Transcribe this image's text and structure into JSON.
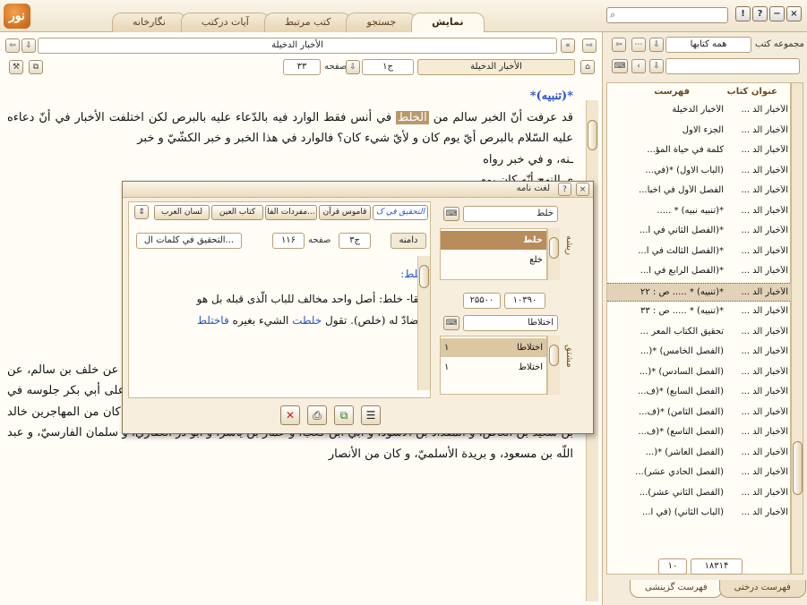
{
  "app": {
    "logo_text": "نور",
    "tabs": [
      {
        "label": "نگارخانه"
      },
      {
        "label": "آیات درکتب"
      },
      {
        "label": "کتب مرتبط"
      },
      {
        "label": "جستجو"
      },
      {
        "label": "نمایش"
      }
    ],
    "window_buttons": [
      "×",
      "−",
      "?",
      "!"
    ]
  },
  "reader": {
    "book_title": "الأخبار الدخيلة",
    "book_field": "الأخبار الدخيلة",
    "volume": "ج۱",
    "page_label": "صفحه",
    "page_number": "۳۳",
    "heading": "*(تنبيه)*",
    "highlight_word": "الخلط",
    "paragraphs": [
      "قد عرفت أنّ الخبر سالم من",
      "في أنس فقط الوارد فيه بالدّعاء عليه بالبرص لكن اختلفت الأخبار في أنّ دعاءه عليه السّلام بالبرص أيّ يوم كان و لأيّ شيء كان؟ فالوارد في هذا الخبر و خبر الكشّيّ و خبر",
      "ـنه، و في خبر رواه",
      "ي النهج أنّه كان يوم",
      "ـامته لا يمكنه، و في",
      "بي بكر جلوسه في",
      "الخلافة» عن عليّ بن أحمد بن عبد اللّه بن أحمد البرقيّ، عن أبيه، عن جدّه أحمد، عن النهيكيّ، عن خلف بن سالم، عن محمّد بن جعفر، عن شعبة، عن عثمان بن المغيرة، عن زيد بن وهب، قال: «كان الّذين أنكروا على أبي بكر جلوسه في الخلافة و تقدّمه على عليّ بن أبي طالب عليه السّلام اثني عشر رجلا من المهاجرين و الأنصار، كان من المهاجرين خالد بن سعيد بن العاص، و المقداد بن الأسود، و أبيّ ابن كعب، و عمّار بن ياسر، و أبو ذرّ الغفاريّ، و سلمان الفارسيّ، و عبد اللّه بن مسعود، و بريدة الأسلميّ، و كان من الأنصار"
    ]
  },
  "side": {
    "collection_label": "مجموعه کتب",
    "collection_value": "همه کتابها",
    "col_title": "عنوان کتاب",
    "col_index": "فهرست",
    "rows": [
      {
        "book": "الأخبار الد ...",
        "index": "الأخبار الدخيلة"
      },
      {
        "book": "الأخبار الد ...",
        "index": "الجزء الاول"
      },
      {
        "book": "الأخبار الد ...",
        "index": "كلمة في حياة المؤ..."
      },
      {
        "book": "الأخبار الد ...",
        "index": "(الباب الاول) *(في..."
      },
      {
        "book": "الأخبار الد ...",
        "index": "الفصل الأول في أخبا..."
      },
      {
        "book": "الأخبار الد ...",
        "index": "*(تنبيه نبيه) * ....."
      },
      {
        "book": "الأخبار الد ...",
        "index": "*(الفصل الثاني في أ..."
      },
      {
        "book": "الأخبار الد ...",
        "index": "*(الفصل الثالث في أ..."
      },
      {
        "book": "الأخبار الد ...",
        "index": "*(الفصل الرابع في ا..."
      },
      {
        "book": "الأخبار الد ...",
        "index": "*(تنبيه) * ..... ص : ۲۲"
      },
      {
        "book": "الأخبار الد ...",
        "index": "*(تنبيه) * ..... ص : ۳۳"
      },
      {
        "book": "الأخبار الد ...",
        "index": "تحقيق الكتاب المعر ..."
      },
      {
        "book": "الأخبار الد ...",
        "index": "(الفصل الخامس) *(..."
      },
      {
        "book": "الأخبار الد ...",
        "index": "(الفصل السادس) *(..."
      },
      {
        "book": "الأخبار الد ...",
        "index": "(الفصل السابع) *(ف..."
      },
      {
        "book": "الأخبار الد ...",
        "index": "(الفصل الثامن) *(ف..."
      },
      {
        "book": "الأخبار الد ...",
        "index": "(الفصل التاسع) *(ف..."
      },
      {
        "book": "الأخبار الد ...",
        "index": "(الفصل العاشر) *(..."
      },
      {
        "book": "الأخبار الد ...",
        "index": "(الفصل الحادي عشر)..."
      },
      {
        "book": "الأخبار الد ...",
        "index": "(الفصل الثاني عشر)..."
      },
      {
        "book": "الأخبار الد ...",
        "index": "(الباب الثاني) (في ا..."
      }
    ],
    "selected_index": 9,
    "count_total": "۱۸۳۱۴",
    "count_shown": "۱۰",
    "bottom_tabs": [
      {
        "label": "فهرست درختی"
      },
      {
        "label": "فهرست گزینشی"
      }
    ]
  },
  "dict": {
    "title": "لغت نامه",
    "dict_tabs": [
      {
        "label": "التحقيق في ک"
      },
      {
        "label": "قاموس قرآن"
      },
      {
        "label": "مفردات الفا..."
      },
      {
        "label": "کتاب العین"
      },
      {
        "label": "لسان العرب"
      }
    ],
    "source_field": "التحقيق في كلمات ال...",
    "volume": "ج۳",
    "page_label": "صفحه",
    "page_number": "۱۱۶",
    "more_button": "دامنه",
    "entry_head": "خلط:",
    "entry_lines": [
      "مقا- خلط: أصل واحد مخالف للباب الّذى قبله بل هو",
      "مضادّ له (خلص). تقول",
      "الشيء بغيره"
    ],
    "blue_word_1": "خلطت",
    "blue_word_2": "فاختلط",
    "search_value": "خلط",
    "root_label": "ریشه",
    "roots": [
      "خلط",
      "خلع"
    ],
    "range_from": "۱۰۳۹۰",
    "range_to": "۲۵۵۰۰",
    "derived_search": "اختلاطا",
    "derived_label": "مشتق",
    "derived": [
      {
        "word": "اختلاطا",
        "count": "۱"
      },
      {
        "word": "اختلاط",
        "count": "۱"
      }
    ]
  }
}
